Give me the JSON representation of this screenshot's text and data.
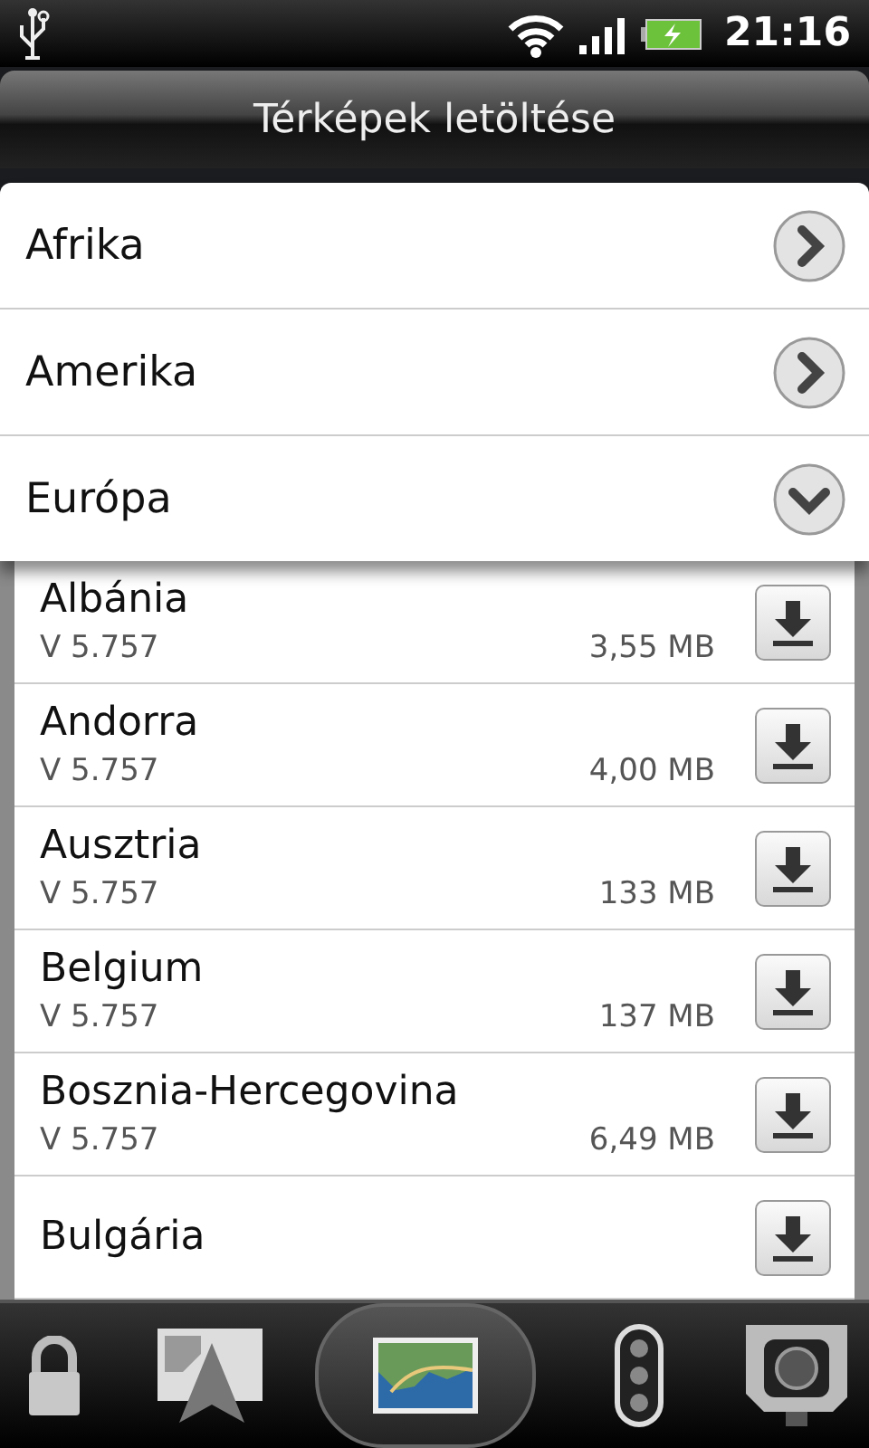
{
  "status_bar": {
    "time": "21:16"
  },
  "title": "Térképek letöltése",
  "categories": [
    {
      "name": "Afrika",
      "expanded": false
    },
    {
      "name": "Amerika",
      "expanded": false
    },
    {
      "name": "Európa",
      "expanded": true
    }
  ],
  "maps": [
    {
      "name": "Albánia",
      "version": "V 5.757",
      "size": "3,55 MB"
    },
    {
      "name": "Andorra",
      "version": "V 5.757",
      "size": "4,00 MB"
    },
    {
      "name": "Ausztria",
      "version": "V 5.757",
      "size": "133 MB"
    },
    {
      "name": "Belgium",
      "version": "V 5.757",
      "size": "137 MB"
    },
    {
      "name": "Bosznia-Hercegovina",
      "version": "V 5.757",
      "size": "6,49 MB"
    },
    {
      "name": "Bulgária"
    }
  ],
  "dock": [
    {
      "selected": false
    },
    {
      "selected": false
    },
    {
      "selected": true
    },
    {
      "selected": false
    },
    {
      "selected": false
    }
  ]
}
